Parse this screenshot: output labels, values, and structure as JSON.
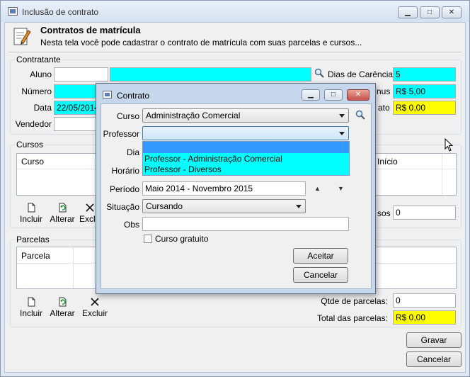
{
  "window": {
    "title": "Inclusão de contrato",
    "minimize_glyph": "▁",
    "maximize_glyph": "□",
    "close_glyph": "✕"
  },
  "header": {
    "title": "Contratos de matrícula",
    "subtitle": "Nesta tela você pode cadastrar o contrato de matrícula com suas parcelas e cursos..."
  },
  "contratante": {
    "legend": "Contratante",
    "aluno_label": "Aluno",
    "aluno_code": "",
    "aluno_name": "",
    "dias_carencia_label": "Dias de Carência",
    "dias_carencia_value": "5",
    "numero_label": "Número",
    "numero_value": "",
    "bonus_label": "nus",
    "bonus_value": "R$ 5,00",
    "data_label": "Data",
    "data_value": "22/05/2014",
    "desconto_label": "ato",
    "desconto_value": "R$ 0,00",
    "vendedor_label": "Vendedor",
    "vendedor_value": ""
  },
  "cursos": {
    "legend": "Cursos",
    "col_curso": "Curso",
    "col_inicio": "Início",
    "tool_incluir": "Incluir",
    "tool_alterar": "Alterar",
    "tool_excluir": "Exclu",
    "qtde_label": "sos",
    "qtde_value": "0"
  },
  "parcelas": {
    "legend": "Parcelas",
    "col_parcela": "Parcela",
    "tool_incluir": "Incluir",
    "tool_alterar": "Alterar",
    "tool_excluir": "Excluir",
    "qtde_label": "Qtde de parcelas:",
    "qtde_value": "0",
    "total_label": "Total das parcelas:",
    "total_value": "R$ 0,00"
  },
  "footer": {
    "gravar": "Gravar",
    "cancelar": "Cancelar"
  },
  "dialog": {
    "title": "Contrato",
    "curso_label": "Curso",
    "curso_value": "Administração Comercial",
    "professor_label": "Professor",
    "professor_value": "",
    "professor_options": [
      "Professor - Administração Comercial",
      "Professor - Diversos"
    ],
    "dia_label": "Dia",
    "horario_label": "Horário",
    "periodo_label": "Período",
    "periodo_value": "Maio 2014 - Novembro 2015",
    "situacao_label": "Situação",
    "situacao_value": "Cursando",
    "obs_label": "Obs",
    "obs_value": "",
    "gratuito_label": "Curso gratuito",
    "aceitar": "Aceitar",
    "cancelar": "Cancelar"
  }
}
